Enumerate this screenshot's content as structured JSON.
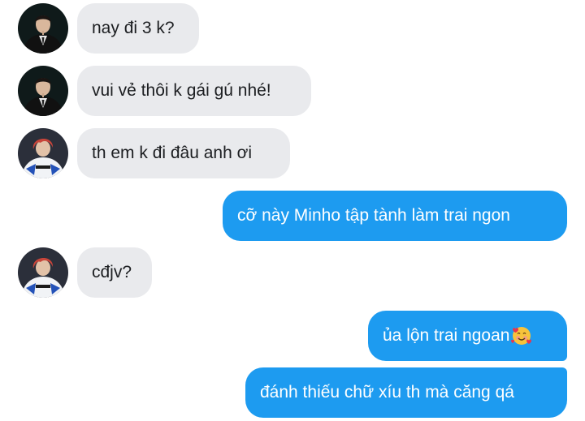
{
  "colors": {
    "incoming_bubble": "#e9eaed",
    "outgoing_bubble": "#1d9bf0",
    "incoming_text": "#1c1e21",
    "outgoing_text": "#ffffff"
  },
  "messages": [
    {
      "direction": "incoming",
      "avatar": "avatar-suit-man",
      "text": "nay đi 3 k?"
    },
    {
      "direction": "incoming",
      "avatar": "avatar-suit-man",
      "text": "vui vẻ thôi k gái gú nhé!"
    },
    {
      "direction": "incoming",
      "avatar": "avatar-red-hair-racer",
      "text": "th em k đi đâu anh ơi"
    },
    {
      "direction": "outgoing",
      "text": "cỡ này Minho tập tành làm trai ngon"
    },
    {
      "direction": "incoming",
      "avatar": "avatar-red-hair-racer",
      "text": "cđjv?"
    },
    {
      "direction": "outgoing",
      "text": "ủa lộn trai ngoan",
      "emoji": "smiling-face-with-hearts-emoji"
    },
    {
      "direction": "outgoing",
      "text": "đánh thiếu chữ xíu th mà căng qá"
    }
  ]
}
